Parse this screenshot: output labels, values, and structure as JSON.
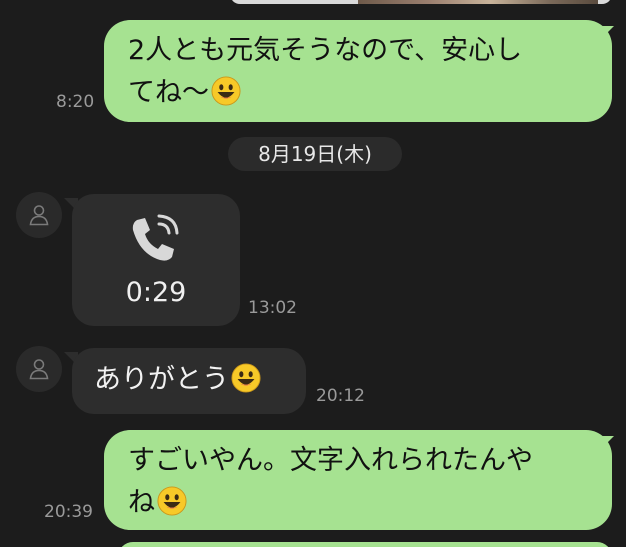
{
  "messages": [
    {
      "id": "m1",
      "sender": "me",
      "lines": [
        "2人とも元気そうなので、安心し",
        "てね〜"
      ],
      "emoji": "smiling-face",
      "time": "8:20"
    },
    {
      "id": "date",
      "date_label": "8月19日(木)"
    },
    {
      "id": "m2",
      "sender": "them",
      "type": "call",
      "duration": "0:29",
      "time": "13:02"
    },
    {
      "id": "m3",
      "sender": "them",
      "text": "ありがとう",
      "emoji": "smiling-face",
      "time": "20:12"
    },
    {
      "id": "m4",
      "sender": "me",
      "lines": [
        "すごいやん。文字入れられたんや",
        "ね"
      ],
      "emoji": "smiling-face",
      "time": "20:39"
    }
  ],
  "colors": {
    "background": "#1c1c1c",
    "my_bubble": "#a6e291",
    "their_bubble": "#2d2d2d",
    "timestamp": "#9a9a9a"
  },
  "icons": {
    "avatar": "default-person-icon",
    "call": "phone-call-icon",
    "emoji": "smiling-face-emoji"
  }
}
